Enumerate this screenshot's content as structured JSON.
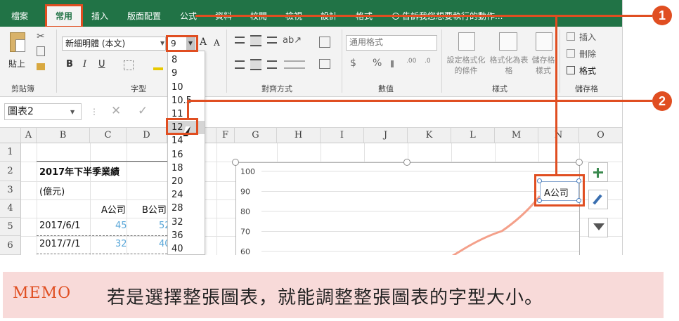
{
  "tabs": [
    "檔案",
    "常用",
    "插入",
    "版面配置",
    "公式",
    "資料",
    "校閱",
    "檢視",
    "設計",
    "格式"
  ],
  "tell_me": "告訴我您想要執行的動作...",
  "ribbon": {
    "paste_label": "貼上",
    "clipboard_group": "剪貼簿",
    "font_name": "新細明體 (本文)",
    "font_size": "9",
    "font_group": "字型",
    "align_group": "對齊方式",
    "number_format": "通用格式",
    "number_group": "數值",
    "cond_format": "設定格式化的條件",
    "format_table": "格式化為表格",
    "cell_styles": "儲存格樣式",
    "styles_group": "樣式",
    "insert": "插入",
    "delete": "刪除",
    "format": "格式",
    "cells_group": "儲存格",
    "bold": "B",
    "italic": "I",
    "underline": "U",
    "currency": "$",
    "percent": "%",
    "grow_font": "A",
    "shrink_font": "A"
  },
  "namebox": "圖表2",
  "columns": [
    "A",
    "B",
    "C",
    "D",
    "E",
    "F",
    "G",
    "H",
    "I",
    "J",
    "K",
    "L",
    "M",
    "N",
    "O"
  ],
  "rows": [
    "1",
    "2",
    "3",
    "4",
    "5",
    "6"
  ],
  "cells": {
    "title": "2017年下半季業績",
    "unit": "(億元)",
    "hdr_a": "A公司",
    "hdr_b": "B公司",
    "r5_date": "2017/6/1",
    "r5_a": "45",
    "r5_b": "52",
    "r6_date": "2017/7/1",
    "r6_a": "32",
    "r6_b": "40"
  },
  "font_sizes": [
    "8",
    "9",
    "10",
    "10.5",
    "11",
    "12",
    "14",
    "16",
    "18",
    "20",
    "24",
    "28",
    "32",
    "36",
    "40"
  ],
  "font_size_hovered": "12",
  "chart": {
    "y_ticks": [
      "100",
      "90",
      "80",
      "70",
      "60"
    ],
    "legend_label": "A公司"
  },
  "side_buttons": [
    "plus-icon",
    "brush-icon",
    "filter-icon"
  ],
  "callouts": [
    "1",
    "2"
  ],
  "memo": {
    "label": "MEMO",
    "text": "若是選擇整張圖表，就能調整整張圖表的字型大小。"
  },
  "colors": {
    "ribbon_green": "#217346",
    "highlight": "#e04e21",
    "memo_bg": "#f8dad9",
    "series_line": "#f4a08a",
    "value_blue": "#5aa7d8"
  }
}
